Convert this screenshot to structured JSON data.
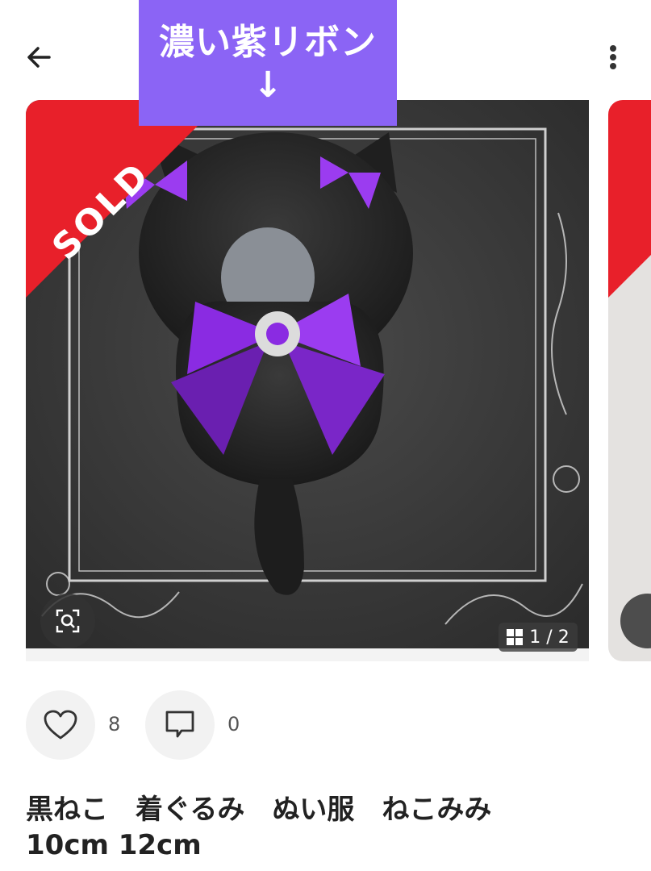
{
  "annotation": {
    "label": "濃い紫リボン",
    "arrow": "↓"
  },
  "image": {
    "sold_badge": "SOLD",
    "counter": "1 / 2",
    "colors": {
      "sold_red": "#e8202a",
      "ribbon_purple": "#8a2be2",
      "callout_purple": "#8b64f5"
    }
  },
  "icons": {
    "back": "arrow-left-icon",
    "more": "more-vertical-icon",
    "zoom": "image-search-icon",
    "gallery": "grid-icon",
    "like": "heart-icon",
    "comment": "comment-icon"
  },
  "stats": {
    "likes": "8",
    "comments": "0"
  },
  "product": {
    "title_line1": "黒ねこ　着ぐるみ　ぬい服　ねこみみ",
    "title_line2": "10cm 12cm"
  }
}
